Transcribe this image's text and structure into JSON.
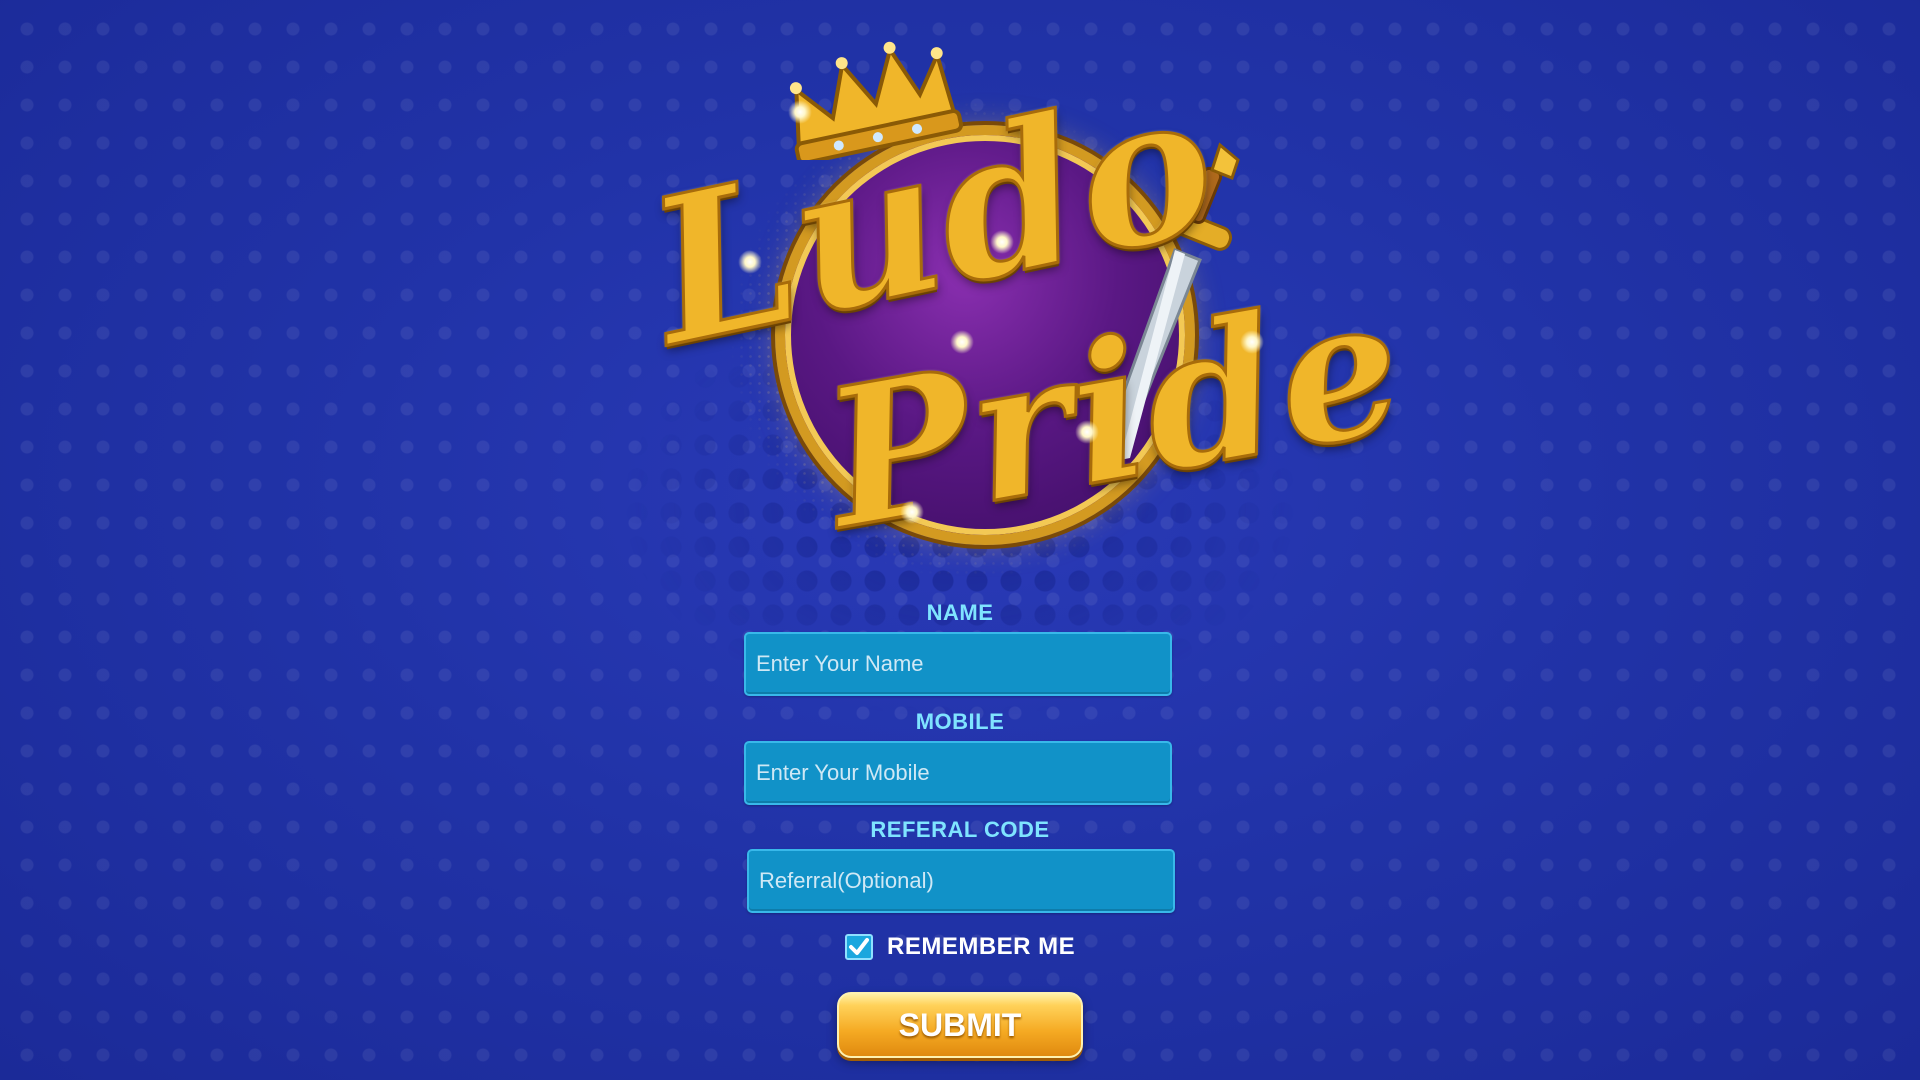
{
  "logo": {
    "line1": "Ludo",
    "line2": "Pride"
  },
  "form": {
    "name": {
      "label": "NAME",
      "placeholder": "Enter Your Name"
    },
    "mobile": {
      "label": "MOBILE",
      "placeholder": "Enter Your Mobile"
    },
    "referral": {
      "label": "REFERAL CODE",
      "placeholder": "Referral(Optional)"
    },
    "remember": {
      "label": "REMEMBER ME",
      "checked": true
    },
    "submit_label": "SUBMIT"
  },
  "colors": {
    "background": "#2133a8",
    "label": "#7fe4ff",
    "input_fill": "#1192c8",
    "submit": "#f5aa23",
    "logo_gold": "#f0b62a",
    "logo_ring": "#5a1884"
  },
  "icons": [
    "crown-icon",
    "sword-icon",
    "check-icon"
  ]
}
